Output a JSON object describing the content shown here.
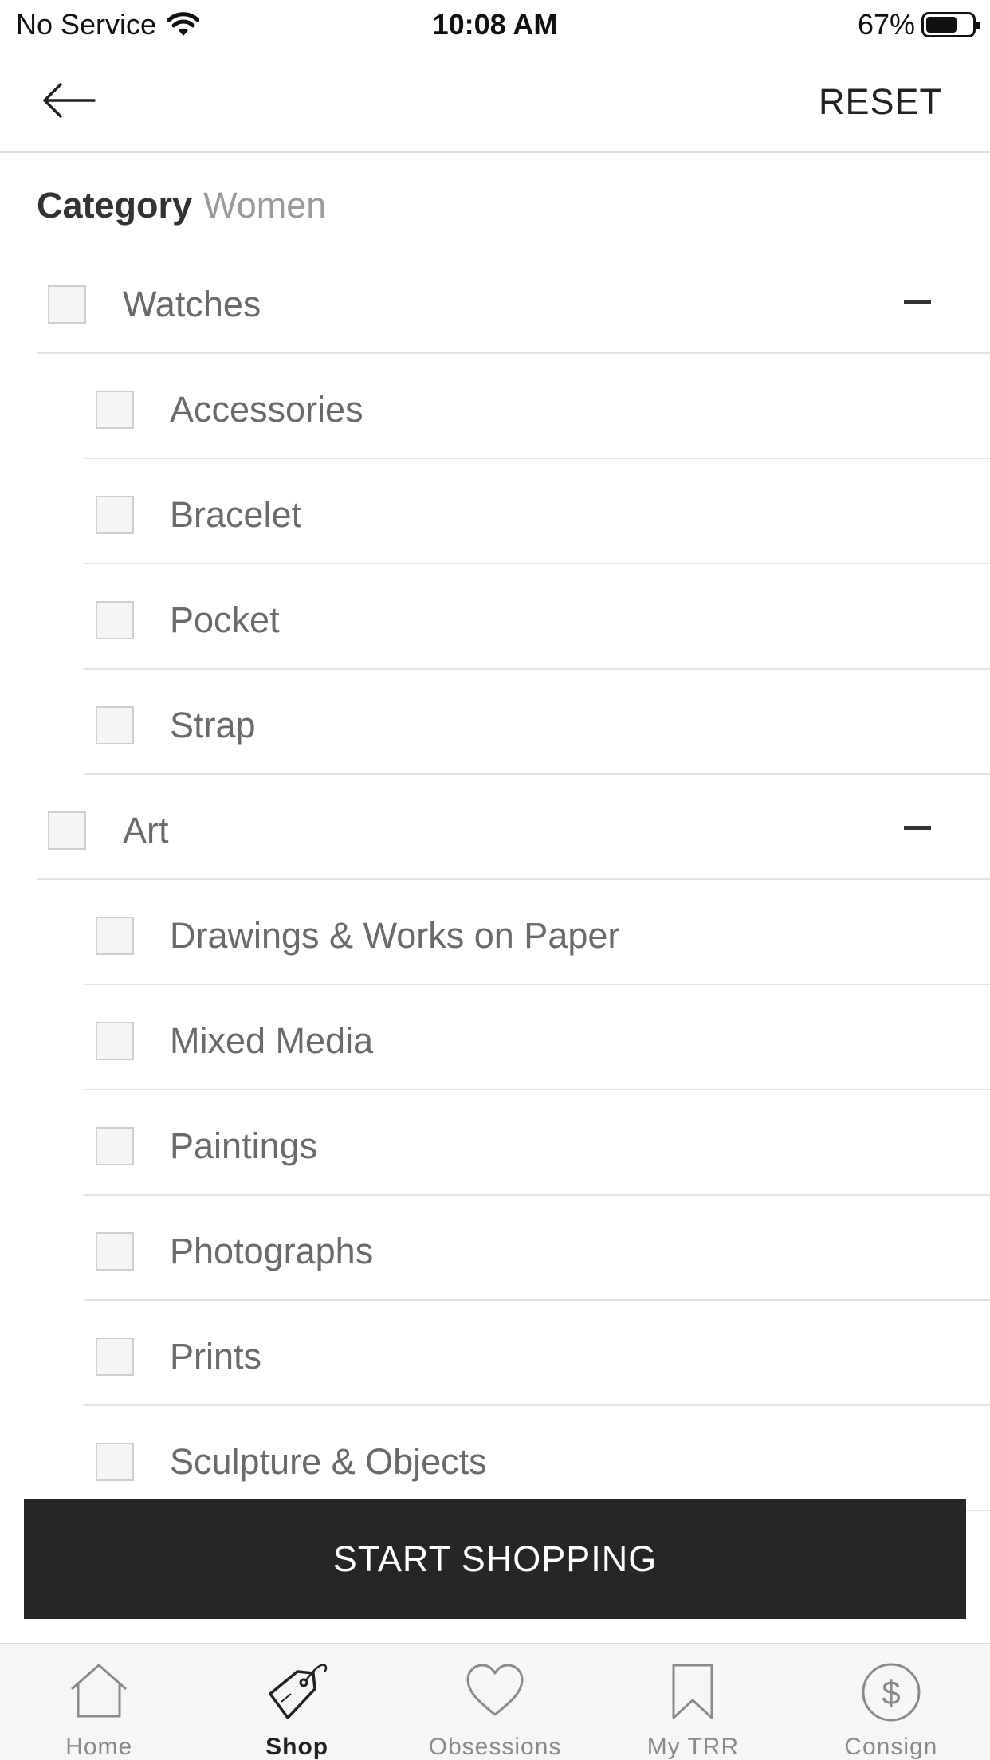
{
  "status_bar": {
    "carrier": "No Service",
    "time": "10:08 AM",
    "battery": "67%",
    "battery_level": 0.67
  },
  "nav": {
    "reset_label": "RESET"
  },
  "filter": {
    "title": "Category",
    "subtitle": "Women",
    "rows": [
      {
        "label": "Watches",
        "level": "parent",
        "collapse_icon": "minus-icon"
      },
      {
        "label": "Accessories",
        "level": "child"
      },
      {
        "label": "Bracelet",
        "level": "child"
      },
      {
        "label": "Pocket",
        "level": "child"
      },
      {
        "label": "Strap",
        "level": "child"
      },
      {
        "label": "Art",
        "level": "parent",
        "collapse_icon": "minus-icon"
      },
      {
        "label": "Drawings & Works on Paper",
        "level": "child"
      },
      {
        "label": "Mixed Media",
        "level": "child"
      },
      {
        "label": "Paintings",
        "level": "child"
      },
      {
        "label": "Photographs",
        "level": "child"
      },
      {
        "label": "Prints",
        "level": "child"
      },
      {
        "label": "Sculpture & Objects",
        "level": "child"
      }
    ]
  },
  "cta": {
    "label": "START SHOPPING"
  },
  "tab_bar": {
    "tabs": [
      {
        "label": "Home",
        "icon": "home-icon",
        "active": false
      },
      {
        "label": "Shop",
        "icon": "tag-icon",
        "active": true
      },
      {
        "label": "Obsessions",
        "icon": "heart-icon",
        "active": false
      },
      {
        "label": "My TRR",
        "icon": "bookmark-icon",
        "active": false
      },
      {
        "label": "Consign",
        "icon": "dollar-icon",
        "active": false
      }
    ]
  }
}
